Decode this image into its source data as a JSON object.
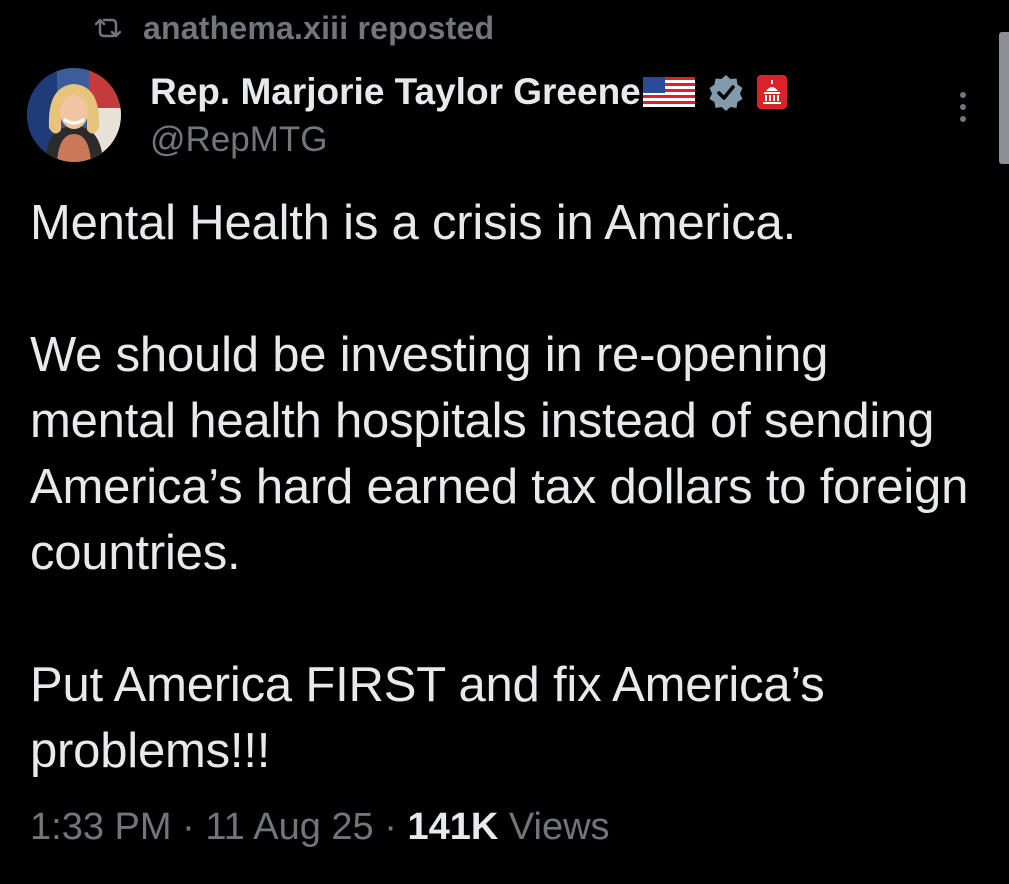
{
  "repost": {
    "icon": "repost-icon",
    "user": "anathema.xiii",
    "label": "reposted"
  },
  "author": {
    "display_name": "Rep. Marjorie Taylor Greene",
    "handle": "@RepMTG",
    "avatar_icon": "avatar",
    "badges": [
      "us-flag-icon",
      "verified-icon",
      "government-badge-icon"
    ]
  },
  "tweet": {
    "paragraphs": [
      "Mental Health is a crisis in America.",
      "We should be investing in re-opening mental health hospitals instead of sending America’s hard earned tax dollars to foreign countries.",
      "Put America FIRST and fix America’s problems!!!"
    ]
  },
  "meta": {
    "time": "1:33 PM",
    "separator": "·",
    "date": "11 Aug 25",
    "views_count": "141K",
    "views_label": "Views"
  },
  "colors": {
    "background": "#000000",
    "text_primary": "#e7e9ea",
    "text_secondary": "#71767b",
    "verified_badge": "#829aab",
    "gov_badge": "#d8232a"
  }
}
